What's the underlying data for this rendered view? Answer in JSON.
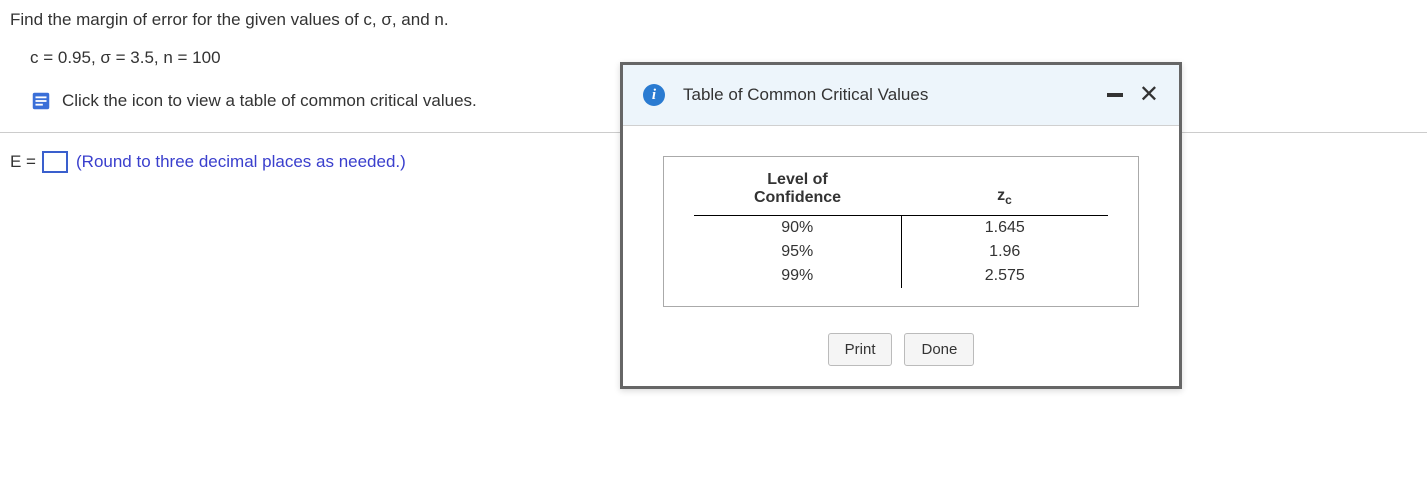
{
  "question": {
    "prompt": "Find the margin of error for the given values of c, σ, and n.",
    "values": "c = 0.95, σ = 3.5, n = 100",
    "link_text": "Click the icon to view a table of common critical values."
  },
  "answer": {
    "label": "E =",
    "hint": "(Round to three decimal places as needed.)"
  },
  "dialog": {
    "title": "Table of Common Critical Values",
    "table": {
      "header_col1_line1": "Level of",
      "header_col1_line2": "Confidence",
      "header_col2_base": "z",
      "header_col2_sub": "c",
      "rows": [
        {
          "level": "90%",
          "z": "1.645"
        },
        {
          "level": "95%",
          "z": "1.96"
        },
        {
          "level": "99%",
          "z": "2.575"
        }
      ]
    },
    "print_label": "Print",
    "done_label": "Done"
  }
}
